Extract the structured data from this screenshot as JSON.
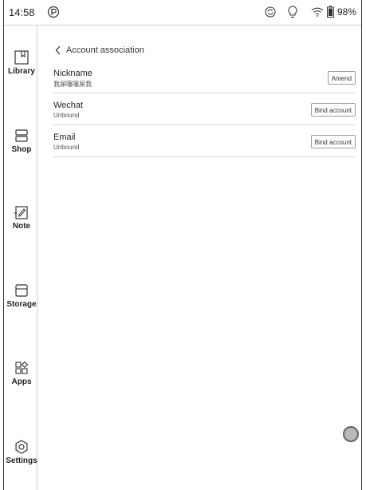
{
  "status_bar": {
    "time": "14:58",
    "battery": "98%",
    "icons": [
      "p-logo-icon",
      "sync-icon",
      "front-light-icon",
      "wifi-icon",
      "battery-icon"
    ]
  },
  "sidebar": {
    "items": [
      {
        "label": "Library",
        "icon": "library-icon"
      },
      {
        "label": "Shop",
        "icon": "shop-icon"
      },
      {
        "label": "Note",
        "icon": "note-icon"
      },
      {
        "label": "Storage",
        "icon": "storage-icon"
      },
      {
        "label": "Apps",
        "icon": "apps-icon"
      },
      {
        "label": "Settings",
        "icon": "settings-icon"
      }
    ]
  },
  "header": {
    "title": "Account association"
  },
  "rows": [
    {
      "name": "Nickname",
      "sub": "我屎噻噻屎我",
      "button": "Amend"
    },
    {
      "name": "Wechat",
      "sub": "Unbound",
      "button": "Bind account"
    },
    {
      "name": "Email",
      "sub": "Unbound",
      "button": "Bind account"
    }
  ]
}
